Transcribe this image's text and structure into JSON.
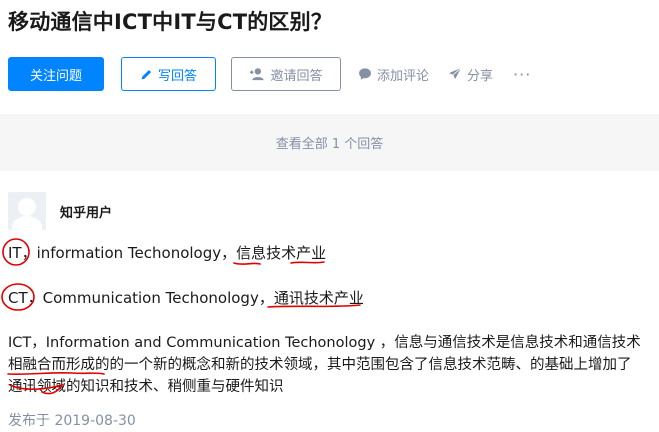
{
  "question": {
    "title": "移动通信中ICT中IT与CT的区别？"
  },
  "actions": {
    "follow_label": "关注问题",
    "write_label": "写回答",
    "invite_label": "邀请回答",
    "comment_label": "添加评论",
    "share_label": "分享",
    "more_label": "···"
  },
  "view_all": {
    "label": "查看全部 1 个回答"
  },
  "answer": {
    "author_name": "知乎用户",
    "line1": "IT，information Techonology，信息技术产业",
    "line2": "CT，Communication Techonology，通讯技术产业",
    "paragraph": [
      "ICT，Information and Communication Techonology ，信息与通信技术是信息技术和通信技术",
      "相融合而形成的的一个新的概念和新的技术领域，其中范围包含了信息技术范畴、的基础上增加了",
      "通讯领域的知识和技术、稍侧重与硬件知识"
    ],
    "published": "发布于 2019-08-30"
  },
  "colors": {
    "primary": "#0084ff",
    "muted": "#8590a6",
    "annotation": "#e00000"
  },
  "icons": [
    "pencil-icon",
    "invite-user-icon",
    "comment-bubble-icon",
    "share-plane-icon",
    "more-dots-icon"
  ]
}
